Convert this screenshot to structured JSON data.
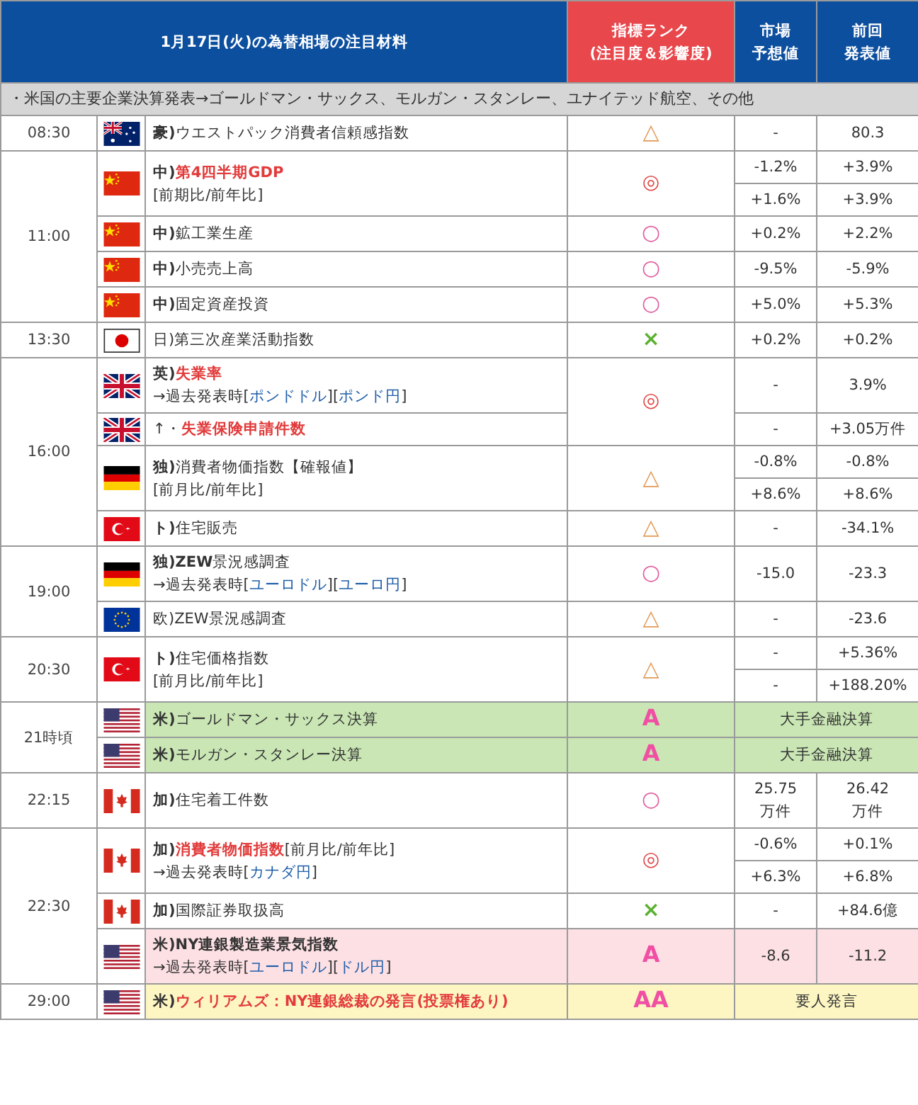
{
  "header": {
    "title": "1月17日(火)の為替相場の注目材料",
    "rank": [
      "指標ランク",
      "(注目度＆影響度)"
    ],
    "forecast": [
      "市場",
      "予想値"
    ],
    "previous": [
      "前回",
      "発表値"
    ]
  },
  "note": "・米国の主要企業決算発表→ゴールドマン・サックス、モルガン・スタンレー、ユナイテッド航空、その他",
  "groups": [
    {
      "time": "08:30",
      "events": [
        {
          "flag": {
            "kind": "au"
          },
          "lines": [
            [
              {
                "text": "豪)",
                "kind": "bold"
              },
              {
                "text": "ウエストパック消費者信頼感指数",
                "kind": "plain"
              }
            ]
          ],
          "rank": {
            "symbol": "△",
            "kind": "triangle"
          },
          "values": [
            {
              "forecast": "-",
              "previous": "80.3"
            }
          ]
        }
      ]
    },
    {
      "time": "11:00",
      "events": [
        {
          "flag": {
            "kind": "cn"
          },
          "lines": [
            [
              {
                "text": "中)",
                "kind": "bold"
              },
              {
                "text": "第4四半期GDP",
                "kind": "red"
              }
            ],
            [
              {
                "text": "[前期比/前年比]",
                "kind": "plain"
              }
            ]
          ],
          "rank": {
            "symbol": "◎",
            "kind": "double"
          },
          "values": [
            {
              "forecast": "-1.2%",
              "previous": "+3.9%"
            },
            {
              "forecast": "+1.6%",
              "previous": "+3.9%"
            }
          ]
        },
        {
          "flag": {
            "kind": "cn"
          },
          "lines": [
            [
              {
                "text": "中)",
                "kind": "bold"
              },
              {
                "text": "鉱工業生産",
                "kind": "plain"
              }
            ]
          ],
          "rank": {
            "symbol": "○",
            "kind": "circle"
          },
          "values": [
            {
              "forecast": "+0.2%",
              "previous": "+2.2%"
            }
          ]
        },
        {
          "flag": {
            "kind": "cn"
          },
          "lines": [
            [
              {
                "text": "中)",
                "kind": "bold"
              },
              {
                "text": "小売売上高",
                "kind": "plain"
              }
            ]
          ],
          "rank": {
            "symbol": "○",
            "kind": "circle"
          },
          "values": [
            {
              "forecast": "-9.5%",
              "previous": "-5.9%"
            }
          ]
        },
        {
          "flag": {
            "kind": "cn"
          },
          "lines": [
            [
              {
                "text": "中)",
                "kind": "bold"
              },
              {
                "text": "固定資産投資",
                "kind": "plain"
              }
            ]
          ],
          "rank": {
            "symbol": "○",
            "kind": "circle"
          },
          "values": [
            {
              "forecast": "+5.0%",
              "previous": "+5.3%"
            }
          ]
        }
      ]
    },
    {
      "time": "13:30",
      "events": [
        {
          "flag": {
            "kind": "jp"
          },
          "lines": [
            [
              {
                "text": "日)",
                "kind": "plain"
              },
              {
                "text": "第三次産業活動指数",
                "kind": "plain"
              }
            ]
          ],
          "rank": {
            "symbol": "×",
            "kind": "cross"
          },
          "values": [
            {
              "forecast": "+0.2%",
              "previous": "+0.2%"
            }
          ]
        }
      ]
    },
    {
      "time": "16:00",
      "events": [
        {
          "flag": {
            "kind": "gb"
          },
          "lines": [
            [
              {
                "text": "英)",
                "kind": "bold"
              },
              {
                "text": "失業率",
                "kind": "red"
              }
            ],
            [
              {
                "text": "→過去発表時[",
                "kind": "plain"
              },
              {
                "text": "ポンドドル",
                "kind": "link"
              },
              {
                "text": "][",
                "kind": "plain"
              },
              {
                "text": "ポンド円",
                "kind": "link"
              },
              {
                "text": "]",
                "kind": "plain"
              }
            ]
          ],
          "rank": {
            "symbol": "◎",
            "kind": "double"
          },
          "values": [
            {
              "forecast": "-",
              "previous": "3.9%"
            }
          ]
        },
        {
          "flag": {
            "kind": "gb"
          },
          "lines": [
            [
              {
                "text": "↑・",
                "kind": "plain"
              },
              {
                "text": "失業保険申請件数",
                "kind": "red"
              }
            ]
          ],
          "values": [
            {
              "forecast": "-",
              "previous": "+3.05万件"
            }
          ]
        },
        {
          "flag": {
            "kind": "de"
          },
          "lines": [
            [
              {
                "text": "独)",
                "kind": "bold"
              },
              {
                "text": "消費者物価指数【確報値】",
                "kind": "plain"
              }
            ],
            [
              {
                "text": "[前月比/前年比]",
                "kind": "plain"
              }
            ]
          ],
          "rank": {
            "symbol": "△",
            "kind": "triangle"
          },
          "values": [
            {
              "forecast": "-0.8%",
              "previous": "-0.8%"
            },
            {
              "forecast": "+8.6%",
              "previous": "+8.6%"
            }
          ]
        },
        {
          "flag": {
            "kind": "tr"
          },
          "lines": [
            [
              {
                "text": "ト)",
                "kind": "bold"
              },
              {
                "text": "住宅販売",
                "kind": "plain"
              }
            ]
          ],
          "rank": {
            "symbol": "△",
            "kind": "triangle"
          },
          "values": [
            {
              "forecast": "-",
              "previous": "-34.1%"
            }
          ]
        }
      ]
    },
    {
      "time": "19:00",
      "events": [
        {
          "flag": {
            "kind": "de"
          },
          "lines": [
            [
              {
                "text": "独)ZEW",
                "kind": "bold"
              },
              {
                "text": "景況感調査",
                "kind": "plain"
              }
            ],
            [
              {
                "text": "→過去発表時[",
                "kind": "plain"
              },
              {
                "text": "ユーロドル",
                "kind": "link"
              },
              {
                "text": "][",
                "kind": "plain"
              },
              {
                "text": "ユーロ円",
                "kind": "link"
              },
              {
                "text": "]",
                "kind": "plain"
              }
            ]
          ],
          "rank": {
            "symbol": "○",
            "kind": "circle"
          },
          "values": [
            {
              "forecast": "-15.0",
              "previous": "-23.3"
            }
          ]
        },
        {
          "flag": {
            "kind": "eu"
          },
          "lines": [
            [
              {
                "text": "欧)",
                "kind": "plain"
              },
              {
                "text": "ZEW景況感調査",
                "kind": "plain"
              }
            ]
          ],
          "rank": {
            "symbol": "△",
            "kind": "triangle"
          },
          "values": [
            {
              "forecast": "-",
              "previous": "-23.6"
            }
          ]
        }
      ]
    },
    {
      "time": "20:30",
      "events": [
        {
          "flag": {
            "kind": "tr"
          },
          "lines": [
            [
              {
                "text": "ト)",
                "kind": "bold"
              },
              {
                "text": "住宅価格指数",
                "kind": "plain"
              }
            ],
            [
              {
                "text": "[前月比/前年比]",
                "kind": "plain"
              }
            ]
          ],
          "rank": {
            "symbol": "△",
            "kind": "triangle"
          },
          "values": [
            {
              "forecast": "-",
              "previous": "+5.36%"
            },
            {
              "forecast": "-",
              "previous": "+188.20%"
            }
          ]
        }
      ]
    },
    {
      "time": "21時頃",
      "events": [
        {
          "flag": {
            "kind": "us"
          },
          "color": "#c9e6b4",
          "lines": [
            [
              {
                "text": "米)",
                "kind": "bold"
              },
              {
                "text": "ゴールドマン・サックス決算",
                "kind": "plain"
              }
            ]
          ],
          "rank": {
            "symbol": "A",
            "kind": "letter"
          },
          "summary": "大手金融決算"
        },
        {
          "flag": {
            "kind": "us"
          },
          "color": "#c9e6b4",
          "lines": [
            [
              {
                "text": "米)",
                "kind": "bold"
              },
              {
                "text": "モルガン・スタンレー決算",
                "kind": "plain"
              }
            ]
          ],
          "rank": {
            "symbol": "A",
            "kind": "letter"
          },
          "summary": "大手金融決算"
        }
      ]
    },
    {
      "time": "22:15",
      "events": [
        {
          "flag": {
            "kind": "ca"
          },
          "lines": [
            [
              {
                "text": "加)",
                "kind": "bold"
              },
              {
                "text": "住宅着工件数",
                "kind": "plain"
              }
            ]
          ],
          "rank": {
            "symbol": "○",
            "kind": "circle"
          },
          "values": [
            {
              "forecast": [
                "25.75",
                "万件"
              ],
              "previous": [
                "26.42",
                "万件"
              ]
            }
          ]
        }
      ]
    },
    {
      "time": "22:30",
      "events": [
        {
          "flag": {
            "kind": "ca"
          },
          "lines": [
            [
              {
                "text": "加)",
                "kind": "bold"
              },
              {
                "text": "消費者物価指数",
                "kind": "red"
              },
              {
                "text": "[前月比/前年比]",
                "kind": "plain"
              }
            ],
            [
              {
                "text": "→過去発表時[",
                "kind": "plain"
              },
              {
                "text": "カナダ円",
                "kind": "link"
              },
              {
                "text": "]",
                "kind": "plain"
              }
            ]
          ],
          "rank": {
            "symbol": "◎",
            "kind": "double"
          },
          "values": [
            {
              "forecast": "-0.6%",
              "previous": "+0.1%"
            },
            {
              "forecast": "+6.3%",
              "previous": "+6.8%"
            }
          ]
        },
        {
          "flag": {
            "kind": "ca"
          },
          "lines": [
            [
              {
                "text": "加)",
                "kind": "bold"
              },
              {
                "text": "国際証券取扱高",
                "kind": "plain"
              }
            ]
          ],
          "rank": {
            "symbol": "×",
            "kind": "cross"
          },
          "values": [
            {
              "forecast": "-",
              "previous": "+84.6億"
            }
          ]
        },
        {
          "flag": {
            "kind": "us"
          },
          "color": "#fde0e4",
          "lines": [
            [
              {
                "text": "米)NY連銀製造業景気指数",
                "kind": "bold"
              }
            ],
            [
              {
                "text": "→過去発表時[",
                "kind": "plain"
              },
              {
                "text": "ユーロドル",
                "kind": "link"
              },
              {
                "text": "][",
                "kind": "plain"
              },
              {
                "text": "ドル円",
                "kind": "link"
              },
              {
                "text": "]",
                "kind": "plain"
              }
            ]
          ],
          "rank": {
            "symbol": "A",
            "kind": "letter"
          },
          "values": [
            {
              "forecast": "-8.6",
              "previous": "-11.2"
            }
          ]
        }
      ]
    },
    {
      "time": "29:00",
      "events": [
        {
          "flag": {
            "kind": "us"
          },
          "color": "#fdf6c3",
          "lines": [
            [
              {
                "text": "米)",
                "kind": "bold"
              },
              {
                "text": "ウィリアムズ：NY連銀総裁の発言(投票権あり)",
                "kind": "red"
              }
            ]
          ],
          "rank": {
            "symbol": "AA",
            "kind": "letter"
          },
          "summary": "要人発言"
        }
      ]
    }
  ]
}
